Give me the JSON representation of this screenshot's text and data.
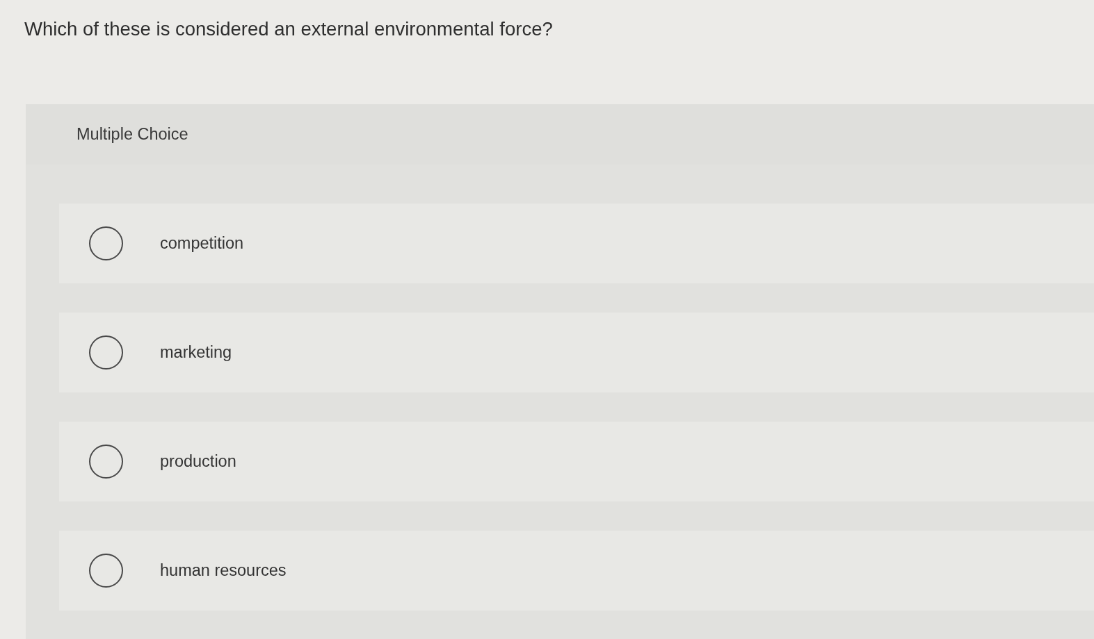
{
  "question": "Which of these is considered an external environmental force?",
  "panel": {
    "label": "Multiple Choice"
  },
  "options": [
    {
      "label": "competition",
      "selected": false
    },
    {
      "label": "marketing",
      "selected": false
    },
    {
      "label": "production",
      "selected": false
    },
    {
      "label": "human resources",
      "selected": false
    }
  ]
}
